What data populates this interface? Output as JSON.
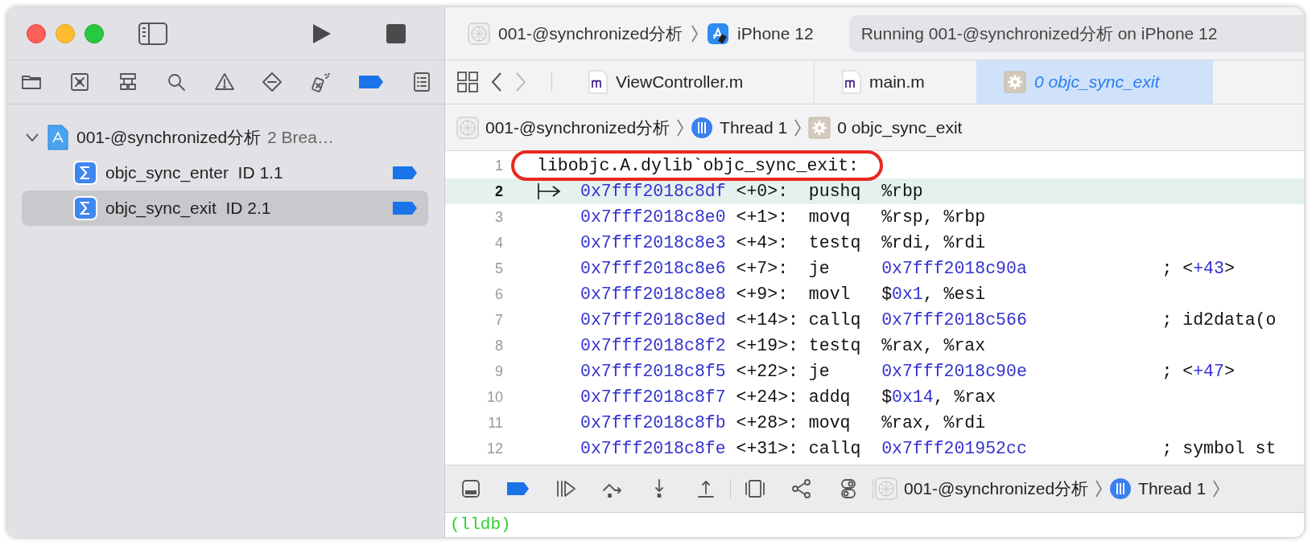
{
  "toolbar": {
    "scheme": "001-@synchronized分析",
    "destination": "iPhone 12",
    "status": "Running 001-@synchronized分析 on iPhone 12"
  },
  "navigator_tabs": [
    {
      "kind": "folder",
      "selected": false
    },
    {
      "kind": "source-control",
      "selected": false
    },
    {
      "kind": "hierarchy",
      "selected": false
    },
    {
      "kind": "search",
      "selected": false
    },
    {
      "kind": "warning",
      "selected": false
    },
    {
      "kind": "test",
      "selected": false
    },
    {
      "kind": "debug",
      "selected": false
    },
    {
      "kind": "breakpoint",
      "selected": true
    },
    {
      "kind": "report",
      "selected": false
    }
  ],
  "breakpoints": {
    "project": {
      "name": "001-@synchronized分析",
      "detail": "2 Brea…",
      "expanded": true
    },
    "items": [
      {
        "name": "objc_sync_enter",
        "id": "ID 1.1",
        "enabled": true,
        "selected": false
      },
      {
        "name": "objc_sync_exit",
        "id": "ID 2.1",
        "enabled": true,
        "selected": true
      }
    ]
  },
  "history": {
    "back_enabled": true,
    "forward_enabled": false
  },
  "editor_tabs": [
    {
      "kind": "source",
      "label": "ViewController.m",
      "selected": false
    },
    {
      "kind": "source",
      "label": "main.m",
      "selected": false
    },
    {
      "kind": "frame",
      "label": "0 objc_sync_exit",
      "selected": true
    }
  ],
  "jump_bar": [
    {
      "kind": "project",
      "label": "001-@synchronized分析"
    },
    {
      "kind": "thread",
      "label": "Thread 1"
    },
    {
      "kind": "frame",
      "label": "0 objc_sync_exit"
    }
  ],
  "code": {
    "lines": [
      {
        "number": "1",
        "kind": "label",
        "text": "libobjc.A.dylib`objc_sync_exit:",
        "annotated": true
      },
      {
        "number": "2",
        "kind": "instruction",
        "current": true,
        "address": "0x7fff2018c8df",
        "offset": "<+0>:",
        "mnemonic": "pushq",
        "operands": [
          {
            "text": "%rbp",
            "kind": "plain"
          }
        ]
      },
      {
        "number": "3",
        "kind": "instruction",
        "current": false,
        "address": "0x7fff2018c8e0",
        "offset": "<+1>:",
        "mnemonic": "movq",
        "operands": [
          {
            "text": "%rsp, %rbp",
            "kind": "plain"
          }
        ]
      },
      {
        "number": "4",
        "kind": "instruction",
        "current": false,
        "address": "0x7fff2018c8e3",
        "offset": "<+4>:",
        "mnemonic": "testq",
        "operands": [
          {
            "text": "%rdi, %rdi",
            "kind": "plain"
          }
        ]
      },
      {
        "number": "5",
        "kind": "instruction",
        "current": false,
        "address": "0x7fff2018c8e6",
        "offset": "<+7>:",
        "mnemonic": "je",
        "operands": [
          {
            "text": "0x7fff2018c90a",
            "kind": "number"
          }
        ],
        "comment": [
          {
            "text": "; <",
            "kind": "plain"
          },
          {
            "text": "+43",
            "kind": "number"
          },
          {
            "text": ">",
            "kind": "plain"
          }
        ]
      },
      {
        "number": "6",
        "kind": "instruction",
        "current": false,
        "address": "0x7fff2018c8e8",
        "offset": "<+9>:",
        "mnemonic": "movl",
        "operands": [
          {
            "text": "$",
            "kind": "plain"
          },
          {
            "text": "0x1",
            "kind": "number"
          },
          {
            "text": ", %esi",
            "kind": "plain"
          }
        ]
      },
      {
        "number": "7",
        "kind": "instruction",
        "current": false,
        "address": "0x7fff2018c8ed",
        "offset": "<+14>:",
        "mnemonic": "callq",
        "operands": [
          {
            "text": "0x7fff2018c566",
            "kind": "number"
          }
        ],
        "comment": [
          {
            "text": "; id2data(o",
            "kind": "plain"
          }
        ]
      },
      {
        "number": "8",
        "kind": "instruction",
        "current": false,
        "address": "0x7fff2018c8f2",
        "offset": "<+19>:",
        "mnemonic": "testq",
        "operands": [
          {
            "text": "%rax, %rax",
            "kind": "plain"
          }
        ]
      },
      {
        "number": "9",
        "kind": "instruction",
        "current": false,
        "address": "0x7fff2018c8f5",
        "offset": "<+22>:",
        "mnemonic": "je",
        "operands": [
          {
            "text": "0x7fff2018c90e",
            "kind": "number"
          }
        ],
        "comment": [
          {
            "text": "; <",
            "kind": "plain"
          },
          {
            "text": "+47",
            "kind": "number"
          },
          {
            "text": ">",
            "kind": "plain"
          }
        ]
      },
      {
        "number": "10",
        "kind": "instruction",
        "current": false,
        "address": "0x7fff2018c8f7",
        "offset": "<+24>:",
        "mnemonic": "addq",
        "operands": [
          {
            "text": "$",
            "kind": "plain"
          },
          {
            "text": "0x14",
            "kind": "number"
          },
          {
            "text": ", %rax",
            "kind": "plain"
          }
        ]
      },
      {
        "number": "11",
        "kind": "instruction",
        "current": false,
        "address": "0x7fff2018c8fb",
        "offset": "<+28>:",
        "mnemonic": "movq",
        "operands": [
          {
            "text": "%rax, %rdi",
            "kind": "plain"
          }
        ]
      },
      {
        "number": "12",
        "kind": "instruction",
        "current": false,
        "address": "0x7fff2018c8fe",
        "offset": "<+31>:",
        "mnemonic": "callq",
        "operands": [
          {
            "text": "0x7fff201952cc",
            "kind": "number"
          }
        ],
        "comment": [
          {
            "text": "; symbol st",
            "kind": "plain"
          }
        ]
      }
    ]
  },
  "debug_bar": {
    "controls": [
      {
        "kind": "console-toggle"
      },
      {
        "kind": "breakpoints",
        "on": true
      },
      {
        "kind": "continue"
      },
      {
        "kind": "step-over"
      },
      {
        "kind": "step-into"
      },
      {
        "kind": "step-out"
      }
    ],
    "tools": [
      {
        "kind": "view-debugger"
      },
      {
        "kind": "memory-graph"
      },
      {
        "kind": "environment"
      }
    ],
    "jump_bar": [
      {
        "kind": "project",
        "label": "001-@synchronized分析"
      },
      {
        "kind": "thread",
        "label": "Thread 1"
      }
    ]
  },
  "console": {
    "prompt": "(lldb)"
  }
}
